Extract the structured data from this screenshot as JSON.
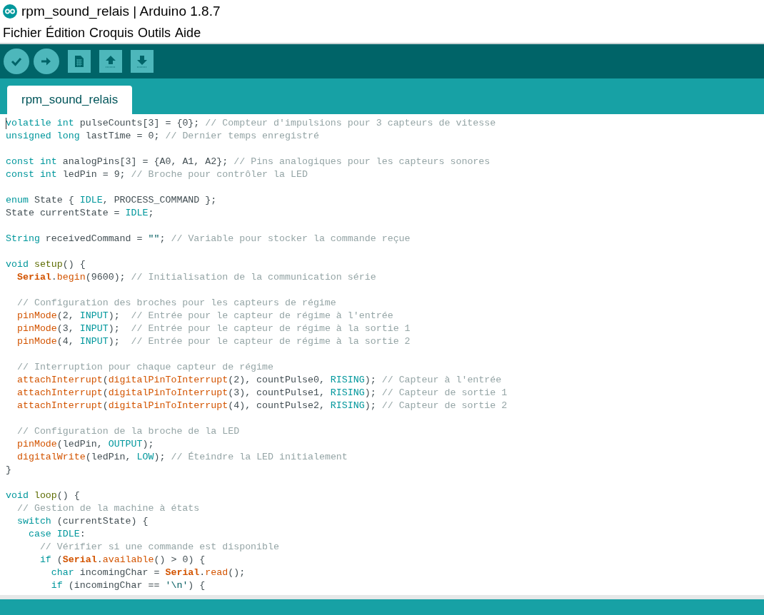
{
  "window": {
    "title": "rpm_sound_relais | Arduino 1.8.7"
  },
  "menu": [
    "Fichier",
    "Édition",
    "Croquis",
    "Outils",
    "Aide"
  ],
  "toolbar": [
    {
      "kind": "verify"
    },
    {
      "kind": "upload"
    },
    {
      "kind": "new"
    },
    {
      "kind": "open"
    },
    {
      "kind": "save"
    }
  ],
  "tabs": [
    {
      "label": "rpm_sound_relais",
      "selected": true
    }
  ],
  "code": {
    "blocks": [
      [
        [
          {
            "kind": "keyword",
            "text": "volatile "
          },
          {
            "kind": "keyword",
            "text": "int"
          },
          {
            "kind": "plain",
            "text": " pulseCounts[3] = {0}; "
          },
          {
            "kind": "comment",
            "text": "// Compteur d'impulsions pour 3 capteurs de vitesse"
          }
        ],
        [
          {
            "kind": "keyword",
            "text": "unsigned "
          },
          {
            "kind": "keyword",
            "text": "long"
          },
          {
            "kind": "plain",
            "text": " lastTime = 0; "
          },
          {
            "kind": "comment",
            "text": "// Dernier temps enregistré"
          }
        ]
      ],
      [
        [
          {
            "kind": "keyword",
            "text": "const "
          },
          {
            "kind": "keyword",
            "text": "int"
          },
          {
            "kind": "plain",
            "text": " analogPins[3] = {A0, A1, A2}; "
          },
          {
            "kind": "comment",
            "text": "// Pins analogiques pour les capteurs sonores"
          }
        ],
        [
          {
            "kind": "keyword",
            "text": "const "
          },
          {
            "kind": "keyword",
            "text": "int"
          },
          {
            "kind": "plain",
            "text": " ledPin = 9; "
          },
          {
            "kind": "comment",
            "text": "// Broche pour contrôler la LED"
          }
        ]
      ],
      [
        [
          {
            "kind": "keyword",
            "text": "enum"
          },
          {
            "kind": "plain",
            "text": " State { "
          },
          {
            "kind": "keyword",
            "text": "IDLE"
          },
          {
            "kind": "plain",
            "text": ", PROCESS_COMMAND };"
          }
        ],
        [
          {
            "kind": "plain",
            "text": "State currentState = "
          },
          {
            "kind": "keyword",
            "text": "IDLE"
          },
          {
            "kind": "plain",
            "text": ";"
          }
        ]
      ],
      [
        [
          {
            "kind": "keyword",
            "text": "String"
          },
          {
            "kind": "plain",
            "text": " receivedCommand = "
          },
          {
            "kind": "string",
            "text": "\"\""
          },
          {
            "kind": "plain",
            "text": "; "
          },
          {
            "kind": "comment",
            "text": "// Variable pour stocker la commande reçue"
          }
        ]
      ],
      [
        [
          {
            "kind": "keyword",
            "text": "void "
          },
          {
            "kind": "structure",
            "text": "setup"
          },
          {
            "kind": "plain",
            "text": "() {"
          }
        ],
        [
          {
            "kind": "class",
            "text": "  Serial"
          },
          {
            "kind": "plain",
            "text": "."
          },
          {
            "kind": "function",
            "text": "begin"
          },
          {
            "kind": "plain",
            "text": "(9600); "
          },
          {
            "kind": "comment",
            "text": "// Initialisation de la communication série"
          }
        ]
      ],
      [
        [
          {
            "kind": "comment",
            "text": "  // Configuration des broches pour les capteurs de régime"
          }
        ],
        [
          {
            "kind": "function",
            "text": "  pinMode"
          },
          {
            "kind": "plain",
            "text": "(2, "
          },
          {
            "kind": "keyword",
            "text": "INPUT"
          },
          {
            "kind": "plain",
            "text": ");  "
          },
          {
            "kind": "comment",
            "text": "// Entrée pour le capteur de régime à l'entrée"
          }
        ],
        [
          {
            "kind": "function",
            "text": "  pinMode"
          },
          {
            "kind": "plain",
            "text": "(3, "
          },
          {
            "kind": "keyword",
            "text": "INPUT"
          },
          {
            "kind": "plain",
            "text": ");  "
          },
          {
            "kind": "comment",
            "text": "// Entrée pour le capteur de régime à la sortie 1"
          }
        ],
        [
          {
            "kind": "function",
            "text": "  pinMode"
          },
          {
            "kind": "plain",
            "text": "(4, "
          },
          {
            "kind": "keyword",
            "text": "INPUT"
          },
          {
            "kind": "plain",
            "text": ");  "
          },
          {
            "kind": "comment",
            "text": "// Entrée pour le capteur de régime à la sortie 2"
          }
        ]
      ],
      [
        [
          {
            "kind": "comment",
            "text": "  // Interruption pour chaque capteur de régime"
          }
        ],
        [
          {
            "kind": "function",
            "text": "  attachInterrupt"
          },
          {
            "kind": "plain",
            "text": "("
          },
          {
            "kind": "function",
            "text": "digitalPinToInterrupt"
          },
          {
            "kind": "plain",
            "text": "(2), countPulse0, "
          },
          {
            "kind": "keyword",
            "text": "RISING"
          },
          {
            "kind": "plain",
            "text": "); "
          },
          {
            "kind": "comment",
            "text": "// Capteur à l'entrée"
          }
        ],
        [
          {
            "kind": "function",
            "text": "  attachInterrupt"
          },
          {
            "kind": "plain",
            "text": "("
          },
          {
            "kind": "function",
            "text": "digitalPinToInterrupt"
          },
          {
            "kind": "plain",
            "text": "(3), countPulse1, "
          },
          {
            "kind": "keyword",
            "text": "RISING"
          },
          {
            "kind": "plain",
            "text": "); "
          },
          {
            "kind": "comment",
            "text": "// Capteur de sortie 1"
          }
        ],
        [
          {
            "kind": "function",
            "text": "  attachInterrupt"
          },
          {
            "kind": "plain",
            "text": "("
          },
          {
            "kind": "function",
            "text": "digitalPinToInterrupt"
          },
          {
            "kind": "plain",
            "text": "(4), countPulse2, "
          },
          {
            "kind": "keyword",
            "text": "RISING"
          },
          {
            "kind": "plain",
            "text": "); "
          },
          {
            "kind": "comment",
            "text": "// Capteur de sortie 2"
          }
        ]
      ],
      [
        [
          {
            "kind": "comment",
            "text": "  // Configuration de la broche de la LED"
          }
        ],
        [
          {
            "kind": "function",
            "text": "  pinMode"
          },
          {
            "kind": "plain",
            "text": "(ledPin, "
          },
          {
            "kind": "keyword",
            "text": "OUTPUT"
          },
          {
            "kind": "plain",
            "text": ");"
          }
        ],
        [
          {
            "kind": "function",
            "text": "  digitalWrite"
          },
          {
            "kind": "plain",
            "text": "(ledPin, "
          },
          {
            "kind": "keyword",
            "text": "LOW"
          },
          {
            "kind": "plain",
            "text": "); "
          },
          {
            "kind": "comment",
            "text": "// Éteindre la LED initialement"
          }
        ],
        [
          {
            "kind": "plain",
            "text": "}"
          }
        ]
      ],
      [
        [
          {
            "kind": "keyword",
            "text": "void "
          },
          {
            "kind": "structure",
            "text": "loop"
          },
          {
            "kind": "plain",
            "text": "() {"
          }
        ],
        [
          {
            "kind": "comment",
            "text": "  // Gestion de la machine à états"
          }
        ],
        [
          {
            "kind": "keyword",
            "text": "  switch"
          },
          {
            "kind": "plain",
            "text": " (currentState) {"
          }
        ],
        [
          {
            "kind": "keyword",
            "text": "    case "
          },
          {
            "kind": "keyword",
            "text": "IDLE"
          },
          {
            "kind": "plain",
            "text": ":"
          }
        ],
        [
          {
            "kind": "comment",
            "text": "      // Vérifier si une commande est disponible"
          }
        ],
        [
          {
            "kind": "keyword",
            "text": "      if"
          },
          {
            "kind": "plain",
            "text": " ("
          },
          {
            "kind": "class",
            "text": "Serial"
          },
          {
            "kind": "plain",
            "text": "."
          },
          {
            "kind": "function",
            "text": "available"
          },
          {
            "kind": "plain",
            "text": "() > 0) {"
          }
        ],
        [
          {
            "kind": "keyword",
            "text": "        char"
          },
          {
            "kind": "plain",
            "text": " incomingChar = "
          },
          {
            "kind": "class",
            "text": "Serial"
          },
          {
            "kind": "plain",
            "text": "."
          },
          {
            "kind": "function",
            "text": "read"
          },
          {
            "kind": "plain",
            "text": "();"
          }
        ],
        [
          {
            "kind": "keyword",
            "text": "        if"
          },
          {
            "kind": "plain",
            "text": " (incomingChar == "
          },
          {
            "kind": "string",
            "text": "'\\n'"
          },
          {
            "kind": "plain",
            "text": ") {"
          }
        ]
      ]
    ]
  }
}
